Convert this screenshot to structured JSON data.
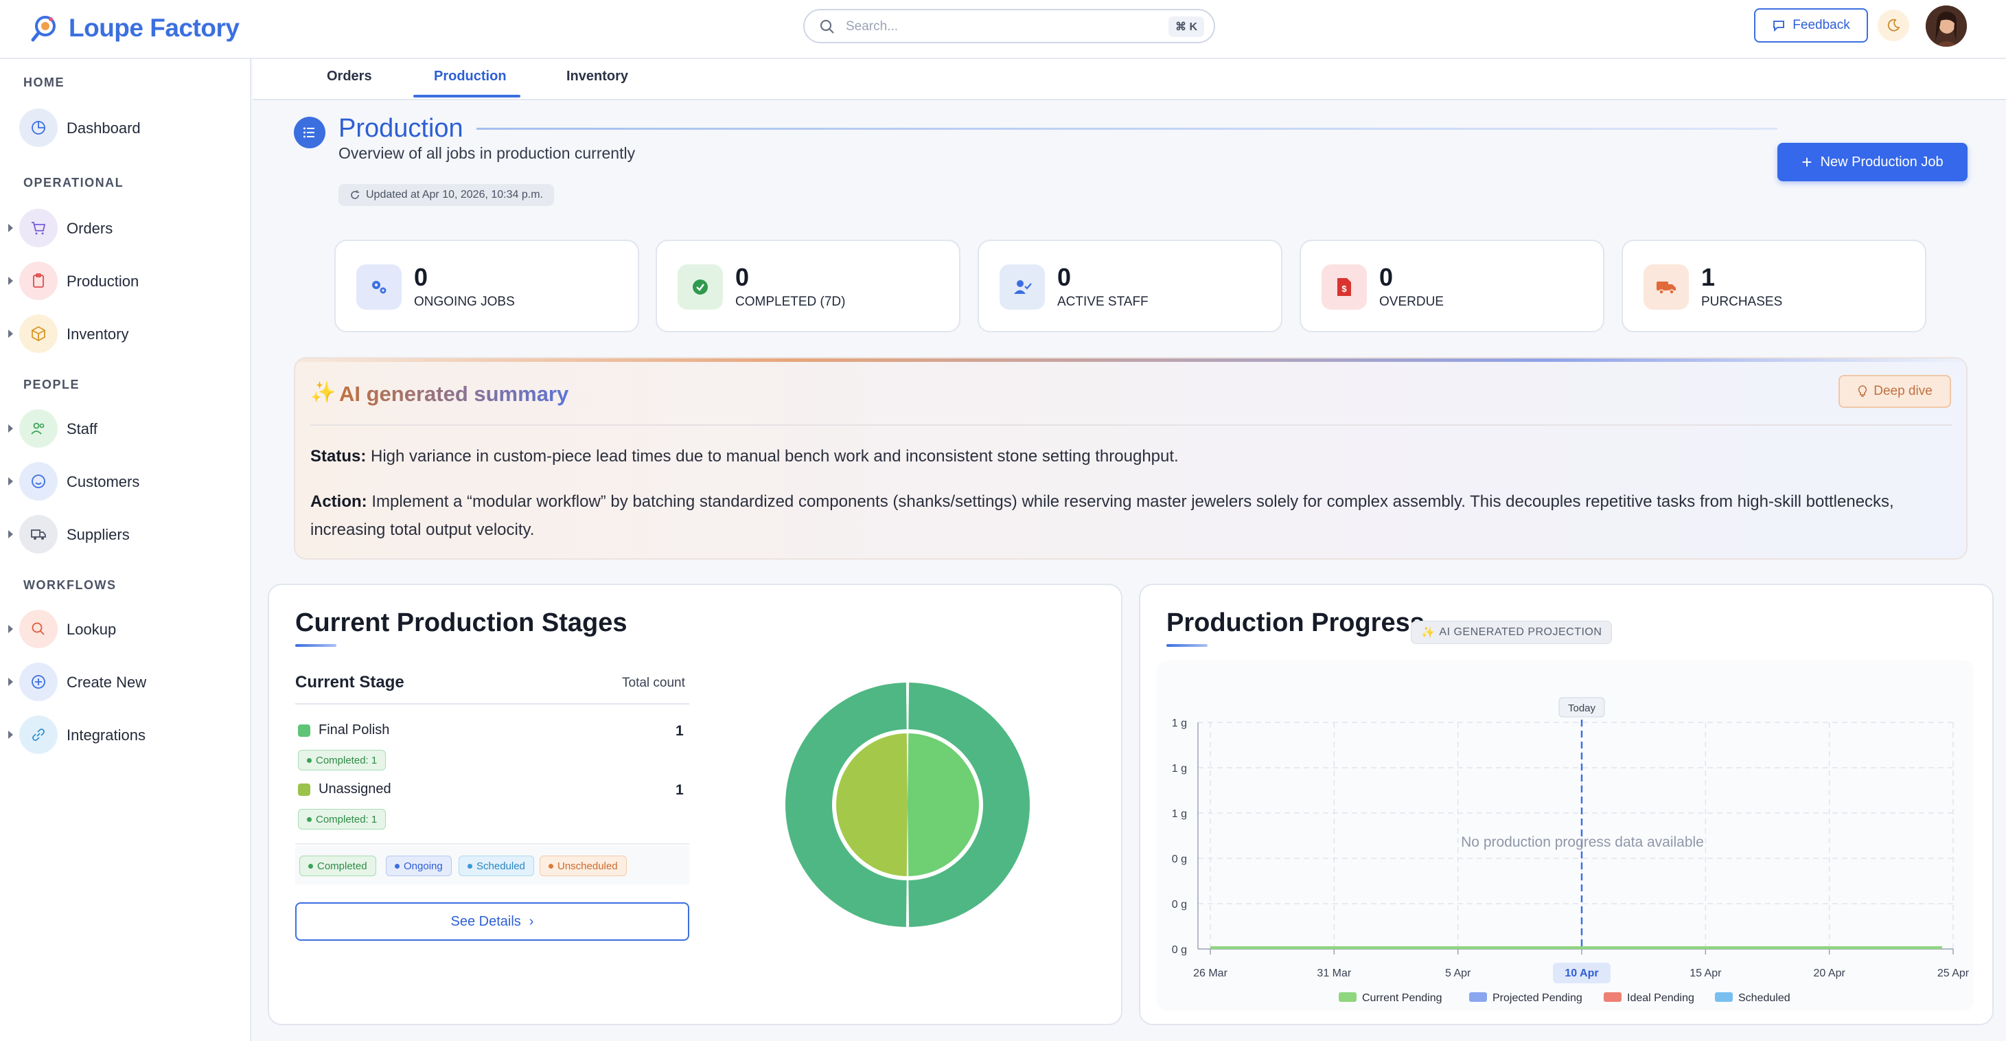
{
  "app": {
    "name": "Loupe Factory"
  },
  "search": {
    "placeholder": "Search...",
    "shortcut": "⌘ K"
  },
  "header": {
    "feedback_label": "Feedback"
  },
  "sidebar": {
    "sections": [
      {
        "label": "HOME",
        "items": [
          {
            "label": "Dashboard",
            "icon": "pie-chart-icon",
            "color": "#e6ebf8"
          }
        ]
      },
      {
        "label": "OPERATIONAL",
        "items": [
          {
            "label": "Orders",
            "icon": "cart-icon",
            "color": "#ece8f8"
          },
          {
            "label": "Production",
            "icon": "clipboard-icon",
            "color": "#fde3e3"
          },
          {
            "label": "Inventory",
            "icon": "box-icon",
            "color": "#fdf0d8"
          }
        ]
      },
      {
        "label": "PEOPLE",
        "items": [
          {
            "label": "Staff",
            "icon": "users-icon",
            "color": "#e2f5e4"
          },
          {
            "label": "Customers",
            "icon": "smile-icon",
            "color": "#e4ebfb"
          },
          {
            "label": "Suppliers",
            "icon": "truck-icon",
            "color": "#e8eaef"
          }
        ]
      },
      {
        "label": "WORKFLOWS",
        "items": [
          {
            "label": "Lookup",
            "icon": "search-icon",
            "color": "#fde5e0"
          },
          {
            "label": "Create New",
            "icon": "plus-circle-icon",
            "color": "#e4ebfb"
          },
          {
            "label": "Integrations",
            "icon": "link-icon",
            "color": "#e0f0fb"
          }
        ]
      }
    ]
  },
  "tabs": [
    {
      "label": "Orders"
    },
    {
      "label": "Production",
      "active": true
    },
    {
      "label": "Inventory"
    }
  ],
  "page": {
    "title": "Production",
    "subtitle": "Overview of all jobs in production currently",
    "updated": "Updated at Apr 10, 2026, 10:34 p.m.",
    "new_job_label": "New Production Job"
  },
  "stats": [
    {
      "value": "0",
      "label": "ONGOING JOBS",
      "icon": "gears-icon",
      "bg": "#e3e9fb"
    },
    {
      "value": "0",
      "label": "COMPLETED (7D)",
      "icon": "check-circle-icon",
      "bg": "#e2f3e4"
    },
    {
      "value": "0",
      "label": "ACTIVE STAFF",
      "icon": "user-check-icon",
      "bg": "#e3ebf8"
    },
    {
      "value": "0",
      "label": "OVERDUE",
      "icon": "invoice-icon",
      "bg": "#fbe1e1"
    },
    {
      "value": "1",
      "label": "PURCHASES",
      "icon": "truck-icon",
      "bg": "#fbe7dc"
    }
  ],
  "ai_summary": {
    "title": "AI generated summary",
    "deep_dive_label": "Deep dive",
    "status_label": "Status:",
    "status_text": "High variance in custom-piece lead times due to manual bench work and inconsistent stone setting throughput.",
    "action_label": "Action:",
    "action_text": "Implement a “modular workflow” by batching standardized components (shanks/settings) while reserving master jewelers solely for complex assembly. This decouples repetitive tasks from high-skill bottlenecks, increasing total output velocity."
  },
  "stages": {
    "title": "Current Production Stages",
    "col_stage": "Current Stage",
    "col_count": "Total count",
    "rows": [
      {
        "name": "Final Polish",
        "count": "1",
        "completed": "Completed: 1",
        "color": "#5fc477"
      },
      {
        "name": "Unassigned",
        "count": "1",
        "completed": "Completed: 1",
        "color": "#9bc24a"
      }
    ],
    "legend": [
      {
        "label": "Completed",
        "color": "#3aa356",
        "bg": "#e6f5e8"
      },
      {
        "label": "Ongoing",
        "color": "#3b6fe0",
        "bg": "#e4ebfb"
      },
      {
        "label": "Scheduled",
        "color": "#3a9ad8",
        "bg": "#e2f1fb"
      },
      {
        "label": "Unscheduled",
        "color": "#e07a3b",
        "bg": "#fdeee2"
      }
    ],
    "see_details_label": "See Details"
  },
  "chart_data": [
    {
      "type": "pie",
      "title": "",
      "rings": [
        {
          "name": "outer",
          "slices": [
            {
              "label": "Final Polish",
              "value": 1,
              "color": "#4fb783"
            },
            {
              "label": "Unassigned",
              "value": 1,
              "color": "#4fb783"
            }
          ]
        },
        {
          "name": "inner",
          "slices": [
            {
              "label": "Final Polish",
              "value": 1,
              "color": "#6fcf73"
            },
            {
              "label": "Unassigned",
              "value": 1,
              "color": "#a4c94a"
            }
          ]
        }
      ]
    },
    {
      "type": "line",
      "title": "Production Progress",
      "tag": "AI GENERATED PROJECTION",
      "empty_message": "No production progress data available",
      "today_label": "Today",
      "today_tick": "10 Apr",
      "x_tick_labels": [
        "26 Mar",
        "31 Mar",
        "5 Apr",
        "10 Apr",
        "15 Apr",
        "20 Apr",
        "25 Apr"
      ],
      "y_tick_labels": [
        "1 g",
        "1 g",
        "1 g",
        "0 g",
        "0 g",
        "0 g"
      ],
      "series": [
        {
          "name": "Current Pending",
          "color": "#8fd67f"
        },
        {
          "name": "Projected Pending",
          "color": "#8aa6ef"
        },
        {
          "name": "Ideal Pending",
          "color": "#ee8073"
        },
        {
          "name": "Scheduled",
          "color": "#78bff0"
        }
      ],
      "grid": true,
      "legend_position": "bottom"
    }
  ]
}
